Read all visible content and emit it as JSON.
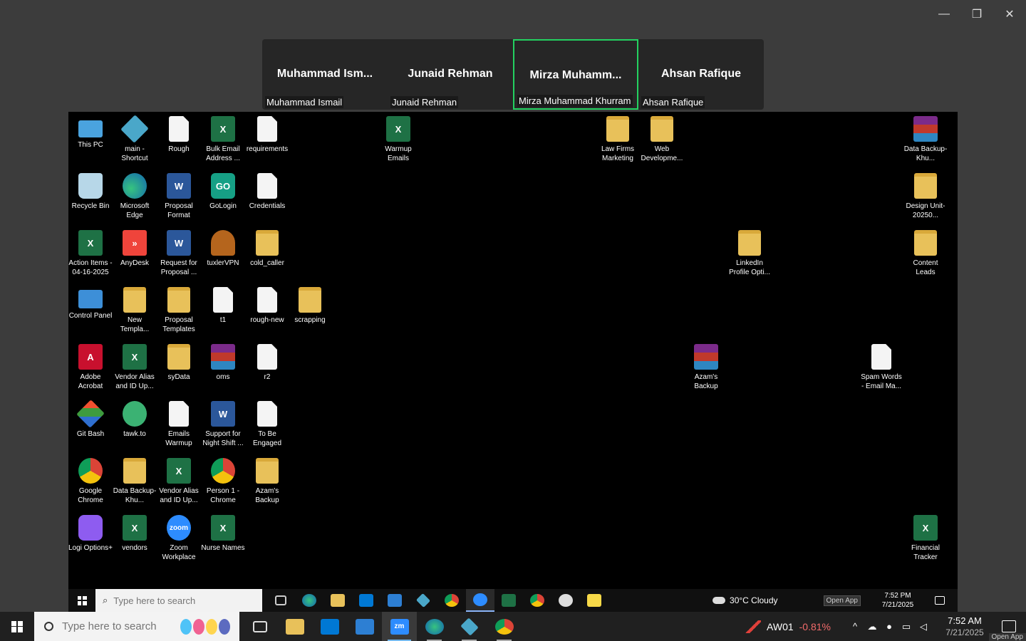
{
  "window_controls": {
    "minimize": "—",
    "restore": "❐",
    "close": "✕"
  },
  "participants": [
    {
      "display": "Muhammad  Ism...",
      "name": "Muhammad Ismail",
      "active": false
    },
    {
      "display": "Junaid Rehman",
      "name": "Junaid Rehman",
      "active": false
    },
    {
      "display": "Mirza  Muhamm...",
      "name": "Mirza Muhammad Khurram",
      "active": true
    },
    {
      "display": "Ahsan Rafique",
      "name": "Ahsan Rafique",
      "active": false
    }
  ],
  "desktop_icons": [
    {
      "label": "This PC",
      "icon": "pc-icon",
      "glyph": ""
    },
    {
      "label": "main - Shortcut",
      "icon": "shortcut-icon",
      "glyph": ""
    },
    {
      "label": "Rough",
      "icon": "file-icon",
      "glyph": ""
    },
    {
      "label": "Bulk Email Address ...",
      "icon": "excel-icon",
      "glyph": "X"
    },
    {
      "label": "requirements",
      "icon": "file-icon",
      "glyph": ""
    },
    {
      "label": "Warmup Emails",
      "icon": "excel-icon",
      "glyph": "X"
    },
    {
      "label": "Law Firms Marketing",
      "icon": "folder-icon",
      "glyph": ""
    },
    {
      "label": "Web Developme...",
      "icon": "folder-icon",
      "glyph": ""
    },
    {
      "label": "Data Backup-Khu...",
      "icon": "archive-icon",
      "glyph": ""
    },
    {
      "label": "Recycle Bin",
      "icon": "recycle-bin-icon",
      "glyph": ""
    },
    {
      "label": "Microsoft Edge",
      "icon": "edge-icon",
      "glyph": ""
    },
    {
      "label": "Proposal Format",
      "icon": "word-icon",
      "glyph": "W"
    },
    {
      "label": "GoLogin",
      "icon": "gologin-icon",
      "glyph": "GO"
    },
    {
      "label": "Credentials",
      "icon": "file-icon",
      "glyph": ""
    },
    {
      "label": "Design Unit-20250...",
      "icon": "folder-icon",
      "glyph": ""
    },
    {
      "label": "Action Items - 04-16-2025",
      "icon": "excel-icon",
      "glyph": "X"
    },
    {
      "label": "AnyDesk",
      "icon": "anydesk-icon",
      "glyph": "»"
    },
    {
      "label": "Request for Proposal ...",
      "icon": "word-icon",
      "glyph": "W"
    },
    {
      "label": "tuxlerVPN",
      "icon": "vpn-icon",
      "glyph": ""
    },
    {
      "label": "cold_caller",
      "icon": "folder-icon",
      "glyph": ""
    },
    {
      "label": "LinkedIn Profile Opti...",
      "icon": "folder-icon",
      "glyph": ""
    },
    {
      "label": "Content Leads",
      "icon": "folder-icon",
      "glyph": ""
    },
    {
      "label": "Control Panel",
      "icon": "control-panel-icon",
      "glyph": ""
    },
    {
      "label": "New Templa...",
      "icon": "folder-icon",
      "glyph": ""
    },
    {
      "label": "Proposal Templates",
      "icon": "folder-icon",
      "glyph": ""
    },
    {
      "label": "t1",
      "icon": "file-icon",
      "glyph": ""
    },
    {
      "label": "rough-new",
      "icon": "file-icon",
      "glyph": ""
    },
    {
      "label": "scrapping",
      "icon": "folder-icon",
      "glyph": ""
    },
    {
      "label": "Adobe Acrobat",
      "icon": "acrobat-icon",
      "glyph": "A"
    },
    {
      "label": "Vendor Alias and ID Up...",
      "icon": "excel-icon",
      "glyph": "X"
    },
    {
      "label": "syData",
      "icon": "folder-icon",
      "glyph": ""
    },
    {
      "label": "oms",
      "icon": "archive-icon",
      "glyph": ""
    },
    {
      "label": "r2",
      "icon": "file-icon",
      "glyph": ""
    },
    {
      "label": "Azam's Backup",
      "icon": "archive-icon",
      "glyph": ""
    },
    {
      "label": "Spam Words - Email Ma...",
      "icon": "file-icon",
      "glyph": ""
    },
    {
      "label": "Git Bash",
      "icon": "git-bash-icon",
      "glyph": ""
    },
    {
      "label": "tawk.to",
      "icon": "tawk-icon",
      "glyph": ""
    },
    {
      "label": "Emails Warmup",
      "icon": "file-icon",
      "glyph": ""
    },
    {
      "label": "Support for Night Shift ...",
      "icon": "word-icon",
      "glyph": "W"
    },
    {
      "label": "To Be Engaged",
      "icon": "file-icon",
      "glyph": ""
    },
    {
      "label": "Google Chrome",
      "icon": "chrome-icon",
      "glyph": ""
    },
    {
      "label": "Data Backup-Khu...",
      "icon": "folder-icon",
      "glyph": ""
    },
    {
      "label": "Vendor Alias and ID Up...",
      "icon": "excel-icon",
      "glyph": "X"
    },
    {
      "label": "Person 1 - Chrome",
      "icon": "chrome-icon",
      "glyph": ""
    },
    {
      "label": "Azam's Backup",
      "icon": "folder-icon",
      "glyph": ""
    },
    {
      "label": "Logi Options+",
      "icon": "logi-icon",
      "glyph": ""
    },
    {
      "label": "vendors",
      "icon": "excel-icon",
      "glyph": "X"
    },
    {
      "label": "Zoom Workplace",
      "icon": "zoom-icon",
      "glyph": "zoom"
    },
    {
      "label": "Nurse Names",
      "icon": "excel-icon",
      "glyph": "X"
    },
    {
      "label": "Financial Tracker",
      "icon": "excel-icon",
      "glyph": "X"
    }
  ],
  "inner_taskbar": {
    "search_placeholder": "Type here to search",
    "weather": "30°C  Cloudy",
    "open_app": "Open App",
    "time": "7:52 PM",
    "date": "7/21/2025"
  },
  "taskbar": {
    "search_placeholder": "Type here to search",
    "zoom_label": "zm",
    "stock_symbol": "AW01",
    "stock_change": "-0.81%",
    "time": "7:52 AM",
    "date": "7/21/2025",
    "open_app": "Open App"
  },
  "colors": {
    "active_speaker": "#23d160",
    "stock_down": "#f26b6b",
    "zoom_blue": "#2d8cff"
  }
}
